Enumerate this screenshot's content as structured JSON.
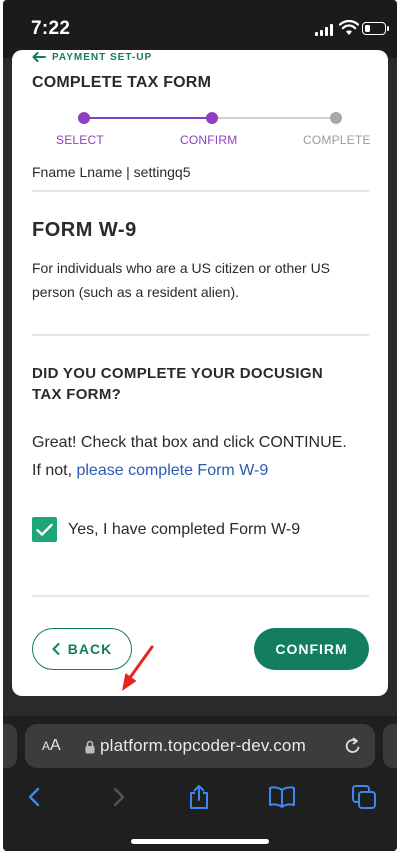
{
  "status_bar": {
    "time": "7:22",
    "battery_level": 0.3
  },
  "header": {
    "back_link_label": "PAYMENT SET-UP",
    "title": "COMPLETE TAX FORM"
  },
  "stepper": {
    "steps": [
      {
        "label": "SELECT",
        "state": "done"
      },
      {
        "label": "CONFIRM",
        "state": "active"
      },
      {
        "label": "COMPLETE",
        "state": "pending"
      }
    ]
  },
  "user": {
    "line": "Fname Lname | settingq5"
  },
  "form": {
    "title": "FORM W-9",
    "description": "For individuals who are a US citizen or other US person (such as a resident alien)."
  },
  "question": {
    "text": "DID YOU COMPLETE YOUR DOCUSIGN TAX FORM?",
    "instruction_line1": "Great! Check that box and click CONTINUE.",
    "instruction_prefix": "If not, ",
    "instruction_link": "please complete Form W-9"
  },
  "checkbox": {
    "checked": true,
    "label": "Yes, I have completed Form W-9"
  },
  "buttons": {
    "back": "BACK",
    "confirm": "CONFIRM"
  },
  "browser": {
    "text_size": "AA",
    "url": "platform.topcoder-dev.com"
  },
  "colors": {
    "brand_green": "#137d60",
    "checkbox_green": "#1fa57a",
    "stepper_purple": "#8e3fc0",
    "link_blue": "#2a5bb0",
    "annotation_red": "#e5261f"
  }
}
